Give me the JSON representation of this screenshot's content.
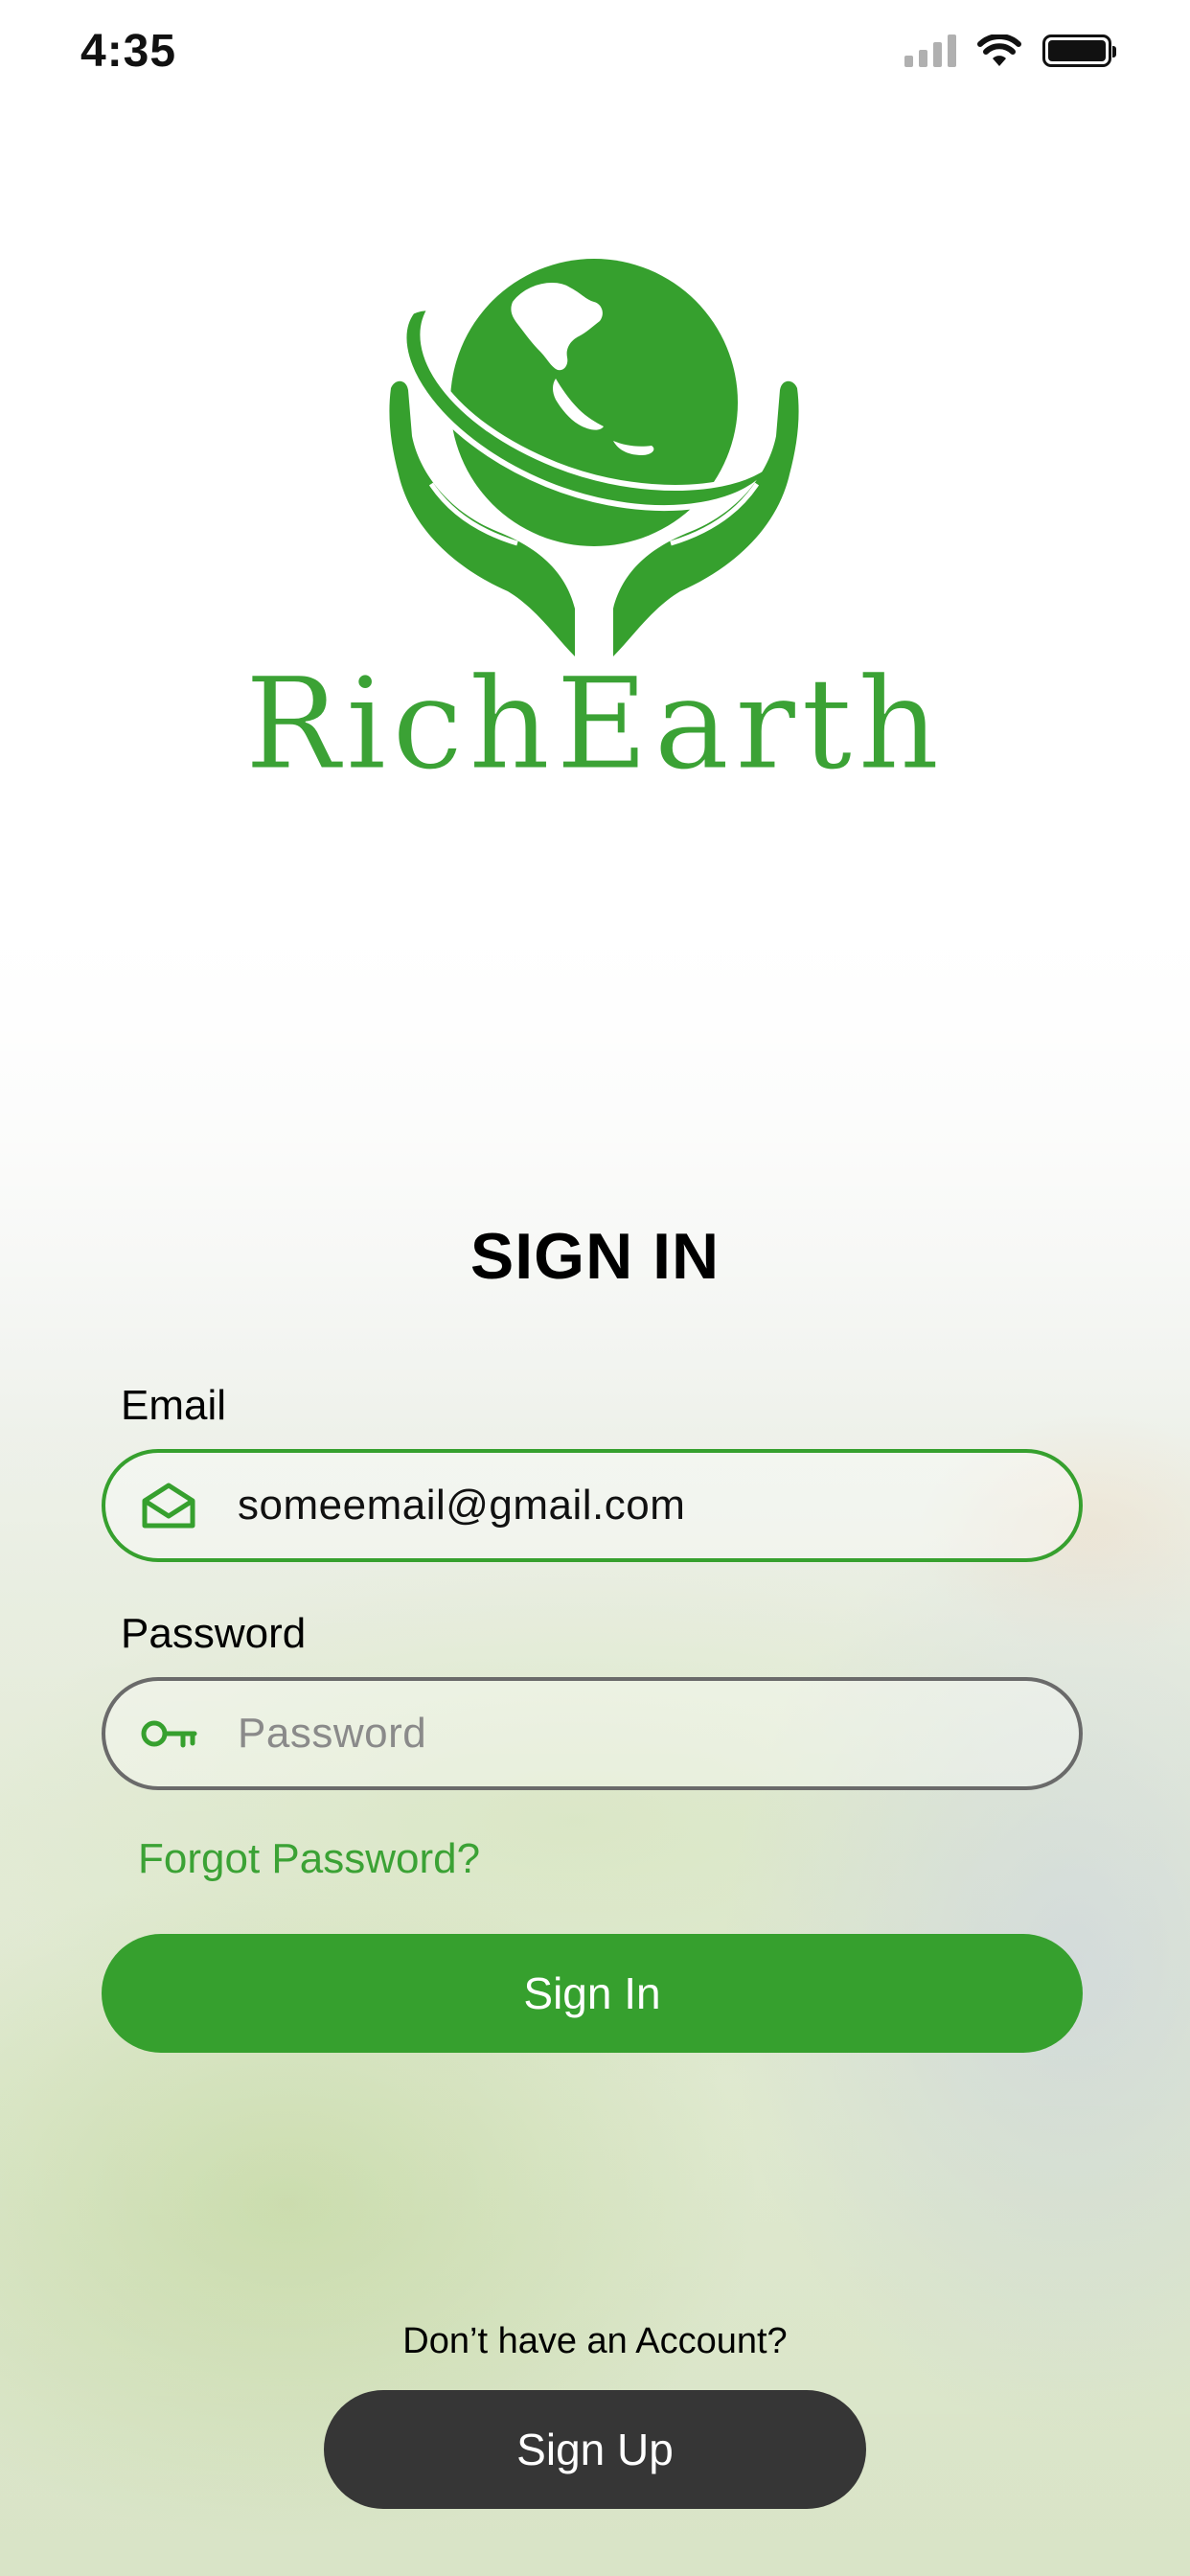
{
  "status_bar": {
    "time": "4:35"
  },
  "brand": {
    "name": "RichEarth",
    "color": "#3ba235"
  },
  "form": {
    "title": "SIGN IN",
    "email": {
      "label": "Email",
      "value": "someemail@gmail.com",
      "icon": "envelope-open-icon"
    },
    "password": {
      "label": "Password",
      "placeholder": "Password",
      "icon": "key-icon"
    },
    "forgot_label": "Forgot Password?",
    "signin_label": "Sign In"
  },
  "footer": {
    "prompt": "Don’t have an Account?",
    "signup_label": "Sign Up"
  },
  "colors": {
    "accent": "#36a02e",
    "signup_button": "#363636"
  }
}
